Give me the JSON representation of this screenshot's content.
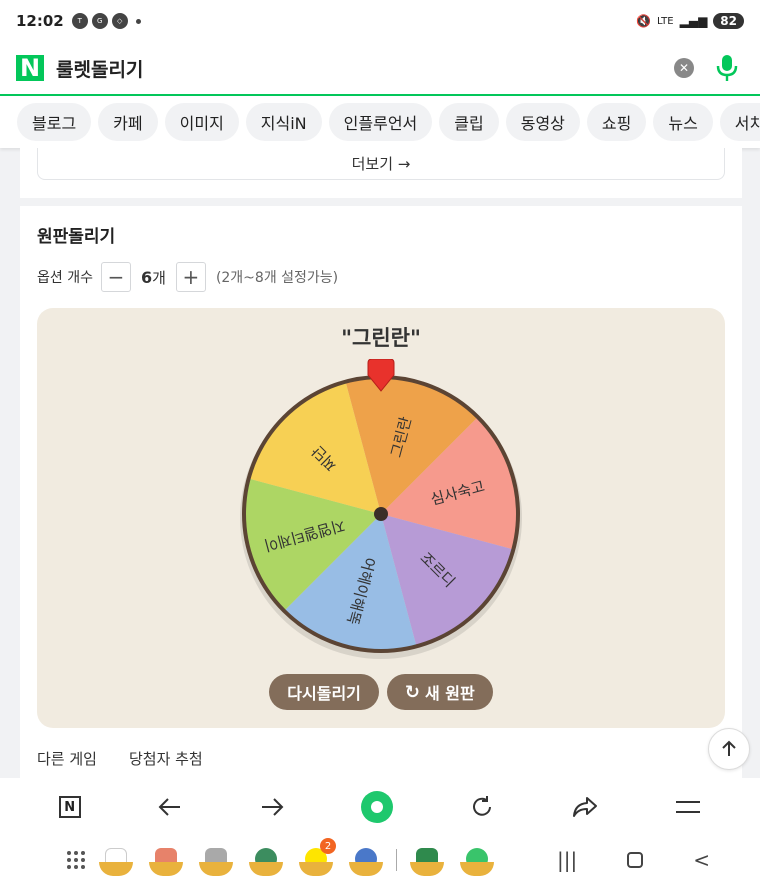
{
  "status": {
    "time": "12:02",
    "battery": "82",
    "icons": [
      "talk-icon",
      "g-icon",
      "sync-icon"
    ]
  },
  "search": {
    "query": "룰렛돌리기"
  },
  "tabs": [
    "블로그",
    "카페",
    "이미지",
    "지식iN",
    "인플루언서",
    "클립",
    "동영상",
    "쇼핑",
    "뉴스",
    "서치피드"
  ],
  "more_label": "더보기 →",
  "roulette": {
    "title": "원판돌리기",
    "option_label": "옵션 개수",
    "option_count": "6",
    "option_unit": "개",
    "option_hint": "(2개~8개 설정가능)",
    "result": "\"그린란\"",
    "segments": [
      {
        "label": "그린란",
        "color": "#eea24a"
      },
      {
        "label": "심사숙고",
        "color": "#f69a8d"
      },
      {
        "label": "조르디",
        "color": "#b79bd6"
      },
      {
        "label": "어헤이해똑",
        "color": "#98bde5"
      },
      {
        "label": "지엠엘티제이",
        "color": "#add664"
      },
      {
        "label": "찌단",
        "color": "#f7d054"
      }
    ],
    "spin_again": "다시돌리기",
    "new_wheel": "새 원판"
  },
  "other": {
    "label": "다른 게임",
    "item": "당첨자 추첨"
  },
  "badge_count": "2"
}
